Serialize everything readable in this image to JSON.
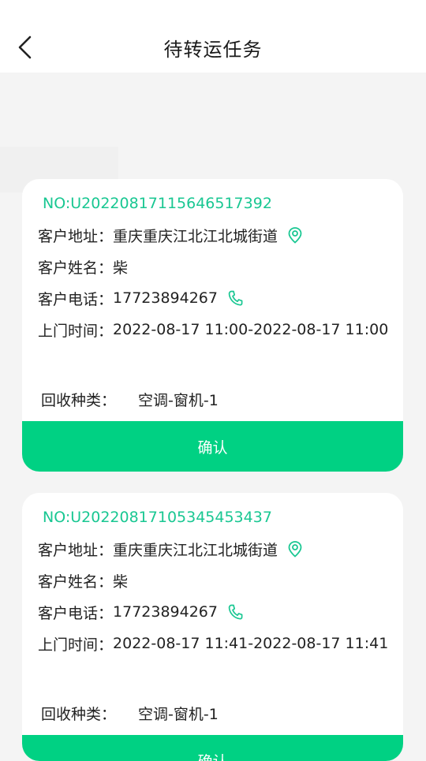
{
  "header": {
    "title": "待转运任务"
  },
  "labels": {
    "address": "客户地址：",
    "name": "客户姓名：",
    "phone": "客户电话：",
    "time": "上门时间：",
    "type": "回收种类："
  },
  "tasks": [
    {
      "order_no": "NO:U20220817115646517392",
      "address": "重庆重庆江北江北城街道",
      "name": "柴",
      "phone": "17723894267",
      "time": "2022-08-17 11:00-2022-08-17 11:00",
      "type": "空调-窗机-1",
      "confirm_label": "确认"
    },
    {
      "order_no": "NO:U20220817105345453437",
      "address": "重庆重庆江北江北城街道",
      "name": "柴",
      "phone": "17723894267",
      "time": "2022-08-17 11:41-2022-08-17 11:41",
      "type": "空调-窗机-1",
      "confirm_label": "确认"
    }
  ],
  "colors": {
    "accent": "#00d183",
    "order_no": "#19c792",
    "background": "#f4f4f4"
  },
  "icons": {
    "back": "chevron-left-icon",
    "location": "location-pin-icon",
    "phone": "phone-icon"
  }
}
